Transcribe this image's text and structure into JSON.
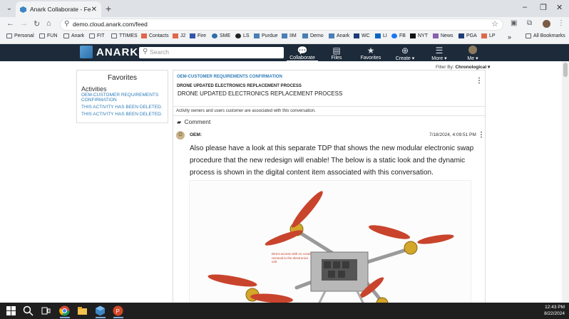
{
  "browser": {
    "tab_title": "Anark Collaborate - Feed",
    "url": "demo.cloud.anark.com/feed",
    "bookmarks": [
      "Personal",
      "FUN",
      "Anark",
      "FIT",
      "TTIMES",
      "Contacts",
      "J2",
      "Fire",
      "SME",
      "LS",
      "Purdue",
      "IIM",
      "Demo",
      "Anark",
      "WC",
      "LI",
      "FB",
      "NYT",
      "News",
      "PGA",
      "LP"
    ],
    "all_bookmarks": "All Bookmarks"
  },
  "app": {
    "logo_text": "ANARK",
    "search_placeholder": "Search",
    "nav": [
      {
        "label": "Collaborate",
        "icon": "chat-icon"
      },
      {
        "label": "Files",
        "icon": "files-icon"
      },
      {
        "label": "Favorites",
        "icon": "star-icon"
      },
      {
        "label": "Create ▾",
        "icon": "plus-circle-icon"
      },
      {
        "label": "More ▾",
        "icon": "hamburger-icon"
      },
      {
        "label": "Me ▾",
        "icon": "avatar-icon"
      }
    ]
  },
  "filter": {
    "label": "Filter By:",
    "value": "Chronological ▾"
  },
  "favorites": {
    "title": "Favorites",
    "activities_heading": "Activities",
    "links": [
      "OEM-CUSTOMER REQUIREMENTS CONFIRMATION",
      "THIS ACTIVITY HAS BEEN DELETED.",
      "THIS ACTIVITY HAS BEEN DELETED."
    ]
  },
  "conversation": {
    "link": "OEM-CUSTOMER REQUIREMENTS CONFIRMATION",
    "subtitle": "DRONE UPDATED ELECTRONICS REPLACEMENT PROCESS",
    "title": "DRONE UPDATED ELECTRONICS REPLACEMENT PROCESS",
    "note": "Activity owners and users customer are associated with this conversation.",
    "comment_label": "Comment"
  },
  "post": {
    "avatar_letter": "O",
    "author": "OEM:",
    "date": "7/18/2024, 4:09:51 PM",
    "text": "Also please have a look at this separate TDP that shows the new modular electronic swap procedure that the new redesign will enable! The below is a static look and the dynamic process is shown in the digital content item associated with this conversation.",
    "image_annotation": "Direct access with no cover removal to the electronics unit"
  },
  "taskbar": {
    "time": "12:43 PM",
    "date": "8/22/2024"
  }
}
